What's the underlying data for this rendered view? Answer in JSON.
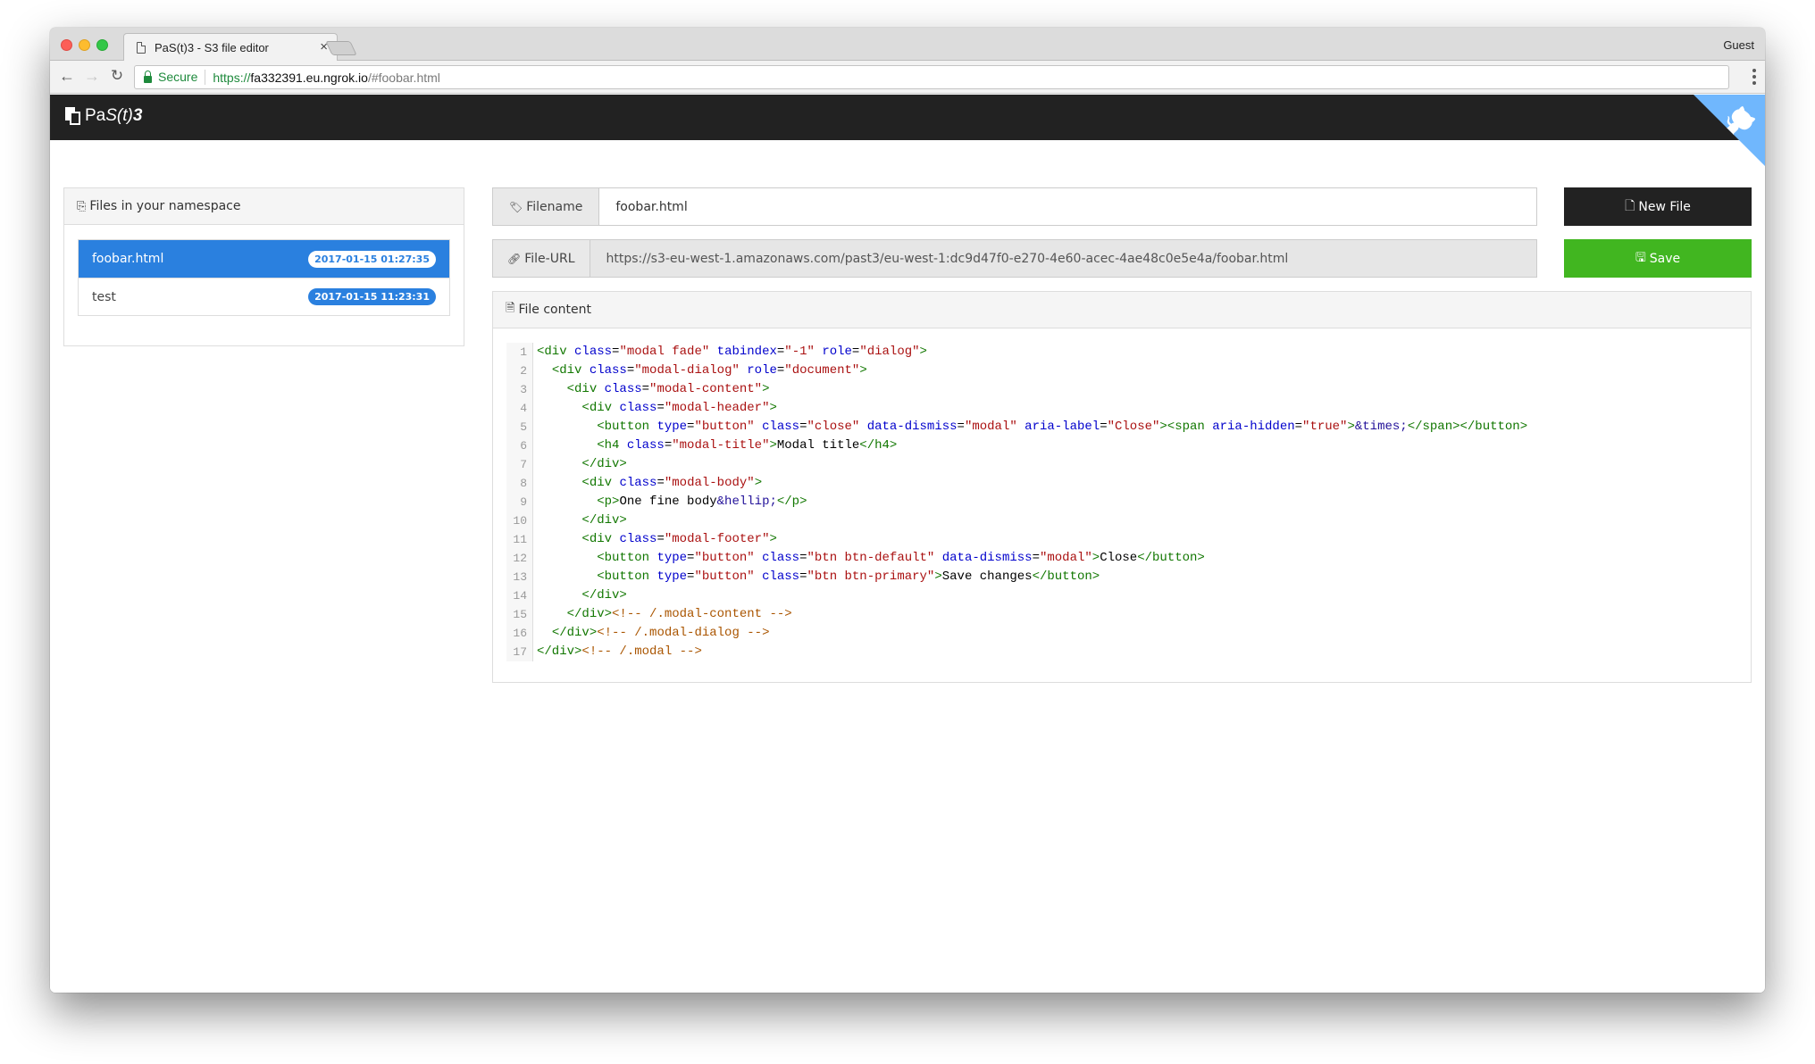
{
  "browser": {
    "tab_title": "PaS(t)3 - S3 file editor",
    "tab_close": "×",
    "profile": "Guest",
    "secure_label": "Secure",
    "url": {
      "scheme": "https://",
      "host": "fa332391.eu.ngrok.io",
      "path": "/#foobar.html"
    },
    "icons": {
      "back": "←",
      "forward": "→",
      "reload": "↻"
    }
  },
  "app": {
    "brand": {
      "plain": "Pa",
      "italic": "S(t)",
      "bold": "3"
    },
    "accent_color": "#2a80df",
    "save_color": "#41b620",
    "files_panel": {
      "title": "Files in your namespace",
      "files": [
        {
          "name": "foobar.html",
          "timestamp": "2017-01-15 01:27:35",
          "active": true
        },
        {
          "name": "test",
          "timestamp": "2017-01-15 11:23:31",
          "active": false
        }
      ]
    },
    "filename": {
      "label": "Filename",
      "value": "foobar.html"
    },
    "file_url": {
      "label": "File-URL",
      "value": "https://s3-eu-west-1.amazonaws.com/past3/eu-west-1:dc9d47f0-e270-4e60-acec-4ae48c0e5e4a/foobar.html"
    },
    "buttons": {
      "new_file": "New File",
      "save": "Save"
    },
    "content_panel": {
      "title": "File content",
      "lines": [
        [
          [
            "tag",
            "<div "
          ],
          [
            "attr",
            "class"
          ],
          [
            "txt",
            "="
          ],
          [
            "str",
            "\"modal fade\""
          ],
          [
            "txt",
            " "
          ],
          [
            "attr",
            "tabindex"
          ],
          [
            "txt",
            "="
          ],
          [
            "str",
            "\"-1\""
          ],
          [
            "txt",
            " "
          ],
          [
            "attr",
            "role"
          ],
          [
            "txt",
            "="
          ],
          [
            "str",
            "\"dialog\""
          ],
          [
            "tag",
            ">"
          ]
        ],
        [
          [
            "txt",
            "  "
          ],
          [
            "tag",
            "<div "
          ],
          [
            "attr",
            "class"
          ],
          [
            "txt",
            "="
          ],
          [
            "str",
            "\"modal-dialog\""
          ],
          [
            "txt",
            " "
          ],
          [
            "attr",
            "role"
          ],
          [
            "txt",
            "="
          ],
          [
            "str",
            "\"document\""
          ],
          [
            "tag",
            ">"
          ]
        ],
        [
          [
            "txt",
            "    "
          ],
          [
            "tag",
            "<div "
          ],
          [
            "attr",
            "class"
          ],
          [
            "txt",
            "="
          ],
          [
            "str",
            "\"modal-content\""
          ],
          [
            "tag",
            ">"
          ]
        ],
        [
          [
            "txt",
            "      "
          ],
          [
            "tag",
            "<div "
          ],
          [
            "attr",
            "class"
          ],
          [
            "txt",
            "="
          ],
          [
            "str",
            "\"modal-header\""
          ],
          [
            "tag",
            ">"
          ]
        ],
        [
          [
            "txt",
            "        "
          ],
          [
            "tag",
            "<button "
          ],
          [
            "attr",
            "type"
          ],
          [
            "txt",
            "="
          ],
          [
            "str",
            "\"button\""
          ],
          [
            "txt",
            " "
          ],
          [
            "attr",
            "class"
          ],
          [
            "txt",
            "="
          ],
          [
            "str",
            "\"close\""
          ],
          [
            "txt",
            " "
          ],
          [
            "attr",
            "data-dismiss"
          ],
          [
            "txt",
            "="
          ],
          [
            "str",
            "\"modal\""
          ],
          [
            "txt",
            " "
          ],
          [
            "attr",
            "aria-label"
          ],
          [
            "txt",
            "="
          ],
          [
            "str",
            "\"Close\""
          ],
          [
            "tag",
            "><span "
          ],
          [
            "attr",
            "aria-hidden"
          ],
          [
            "txt",
            "="
          ],
          [
            "str",
            "\"true\""
          ],
          [
            "tag",
            ">"
          ],
          [
            "ent",
            "&times;"
          ],
          [
            "tag",
            "</span></button>"
          ]
        ],
        [
          [
            "txt",
            "        "
          ],
          [
            "tag",
            "<h4 "
          ],
          [
            "attr",
            "class"
          ],
          [
            "txt",
            "="
          ],
          [
            "str",
            "\"modal-title\""
          ],
          [
            "tag",
            ">"
          ],
          [
            "txt",
            "Modal title"
          ],
          [
            "tag",
            "</h4>"
          ]
        ],
        [
          [
            "txt",
            "      "
          ],
          [
            "tag",
            "</div>"
          ]
        ],
        [
          [
            "txt",
            "      "
          ],
          [
            "tag",
            "<div "
          ],
          [
            "attr",
            "class"
          ],
          [
            "txt",
            "="
          ],
          [
            "str",
            "\"modal-body\""
          ],
          [
            "tag",
            ">"
          ]
        ],
        [
          [
            "txt",
            "        "
          ],
          [
            "tag",
            "<p>"
          ],
          [
            "txt",
            "One fine body"
          ],
          [
            "ent",
            "&hellip;"
          ],
          [
            "tag",
            "</p>"
          ]
        ],
        [
          [
            "txt",
            "      "
          ],
          [
            "tag",
            "</div>"
          ]
        ],
        [
          [
            "txt",
            "      "
          ],
          [
            "tag",
            "<div "
          ],
          [
            "attr",
            "class"
          ],
          [
            "txt",
            "="
          ],
          [
            "str",
            "\"modal-footer\""
          ],
          [
            "tag",
            ">"
          ]
        ],
        [
          [
            "txt",
            "        "
          ],
          [
            "tag",
            "<button "
          ],
          [
            "attr",
            "type"
          ],
          [
            "txt",
            "="
          ],
          [
            "str",
            "\"button\""
          ],
          [
            "txt",
            " "
          ],
          [
            "attr",
            "class"
          ],
          [
            "txt",
            "="
          ],
          [
            "str",
            "\"btn btn-default\""
          ],
          [
            "txt",
            " "
          ],
          [
            "attr",
            "data-dismiss"
          ],
          [
            "txt",
            "="
          ],
          [
            "str",
            "\"modal\""
          ],
          [
            "tag",
            ">"
          ],
          [
            "txt",
            "Close"
          ],
          [
            "tag",
            "</button>"
          ]
        ],
        [
          [
            "txt",
            "        "
          ],
          [
            "tag",
            "<button "
          ],
          [
            "attr",
            "type"
          ],
          [
            "txt",
            "="
          ],
          [
            "str",
            "\"button\""
          ],
          [
            "txt",
            " "
          ],
          [
            "attr",
            "class"
          ],
          [
            "txt",
            "="
          ],
          [
            "str",
            "\"btn btn-primary\""
          ],
          [
            "tag",
            ">"
          ],
          [
            "txt",
            "Save changes"
          ],
          [
            "tag",
            "</button>"
          ]
        ],
        [
          [
            "txt",
            "      "
          ],
          [
            "tag",
            "</div>"
          ]
        ],
        [
          [
            "txt",
            "    "
          ],
          [
            "tag",
            "</div>"
          ],
          [
            "com",
            "<!-- /.modal-content -->"
          ]
        ],
        [
          [
            "txt",
            "  "
          ],
          [
            "tag",
            "</div>"
          ],
          [
            "com",
            "<!-- /.modal-dialog -->"
          ]
        ],
        [
          [
            "tag",
            "</div>"
          ],
          [
            "com",
            "<!-- /.modal -->"
          ]
        ]
      ]
    }
  }
}
